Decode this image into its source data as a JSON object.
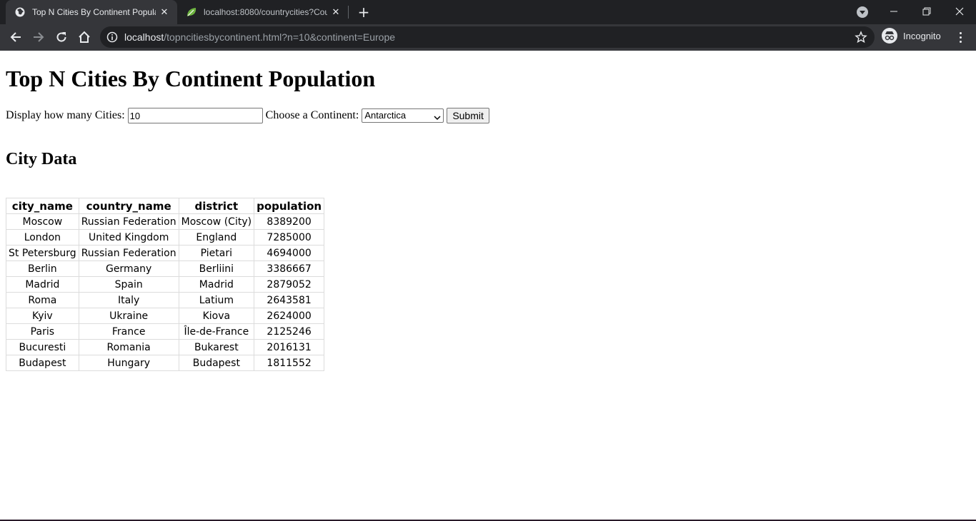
{
  "browser": {
    "tabs": [
      {
        "title": "Top N Cities By Continent Popula",
        "favicon": "globe-icon",
        "active": true
      },
      {
        "title": "localhost:8080/countrycities?Cou",
        "favicon": "spring-leaf-icon",
        "active": false
      }
    ],
    "address": {
      "host": "localhost",
      "path": "/topncitiesbycontinent.html?n=10&continent=Europe"
    },
    "profile_label": "Incognito",
    "colors": {
      "tabstrip": "#202124",
      "toolbar": "#35363a",
      "leaf": "#6db33f"
    }
  },
  "page": {
    "heading": "Top N Cities By Continent Population",
    "form": {
      "count_label": "Display how many Cities:",
      "count_value": "10",
      "continent_label": "Choose a Continent:",
      "continent_selected": "Antarctica",
      "submit_label": "Submit"
    },
    "subheading": "City Data",
    "table": {
      "columns": [
        "city_name",
        "country_name",
        "district",
        "population"
      ],
      "rows": [
        [
          "Moscow",
          "Russian Federation",
          "Moscow (City)",
          "8389200"
        ],
        [
          "London",
          "United Kingdom",
          "England",
          "7285000"
        ],
        [
          "St Petersburg",
          "Russian Federation",
          "Pietari",
          "4694000"
        ],
        [
          "Berlin",
          "Germany",
          "Berliini",
          "3386667"
        ],
        [
          "Madrid",
          "Spain",
          "Madrid",
          "2879052"
        ],
        [
          "Roma",
          "Italy",
          "Latium",
          "2643581"
        ],
        [
          "Kyiv",
          "Ukraine",
          "Kiova",
          "2624000"
        ],
        [
          "Paris",
          "France",
          "Île-de-France",
          "2125246"
        ],
        [
          "Bucuresti",
          "Romania",
          "Bukarest",
          "2016131"
        ],
        [
          "Budapest",
          "Hungary",
          "Budapest",
          "1811552"
        ]
      ]
    }
  }
}
